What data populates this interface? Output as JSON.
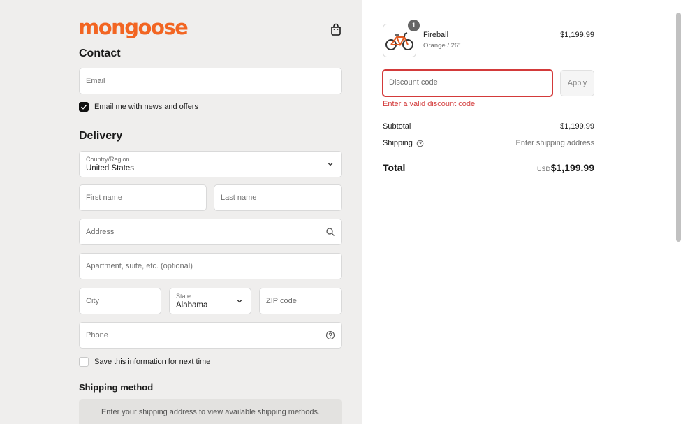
{
  "brand": {
    "logo_text": "mongoose",
    "accent": "#f26522"
  },
  "contact": {
    "title": "Contact",
    "email_placeholder": "Email",
    "news_label": "Email me with news and offers",
    "news_checked": true
  },
  "delivery": {
    "title": "Delivery",
    "country_label": "Country/Region",
    "country_value": "United States",
    "first_name_placeholder": "First name",
    "last_name_placeholder": "Last name",
    "address_placeholder": "Address",
    "apartment_placeholder": "Apartment, suite, etc. (optional)",
    "city_placeholder": "City",
    "state_label": "State",
    "state_value": "Alabama",
    "zip_placeholder": "ZIP code",
    "phone_placeholder": "Phone",
    "save_info_label": "Save this information for next time"
  },
  "shipping_method": {
    "title": "Shipping method",
    "message": "Enter your shipping address to view available shipping methods."
  },
  "summary": {
    "product": {
      "name": "Fireball",
      "variant": "Orange / 26\"",
      "price": "$1,199.99",
      "quantity": "1"
    },
    "discount_placeholder": "Discount code",
    "apply_label": "Apply",
    "discount_error": "Enter a valid discount code",
    "subtotal_label": "Subtotal",
    "subtotal_value": "$1,199.99",
    "shipping_label": "Shipping",
    "shipping_value": "Enter shipping address",
    "total_label": "Total",
    "total_currency": "USD",
    "total_value": "$1,199.99"
  },
  "colors": {
    "error": "#d33a3a",
    "left_bg": "#efeeed"
  }
}
